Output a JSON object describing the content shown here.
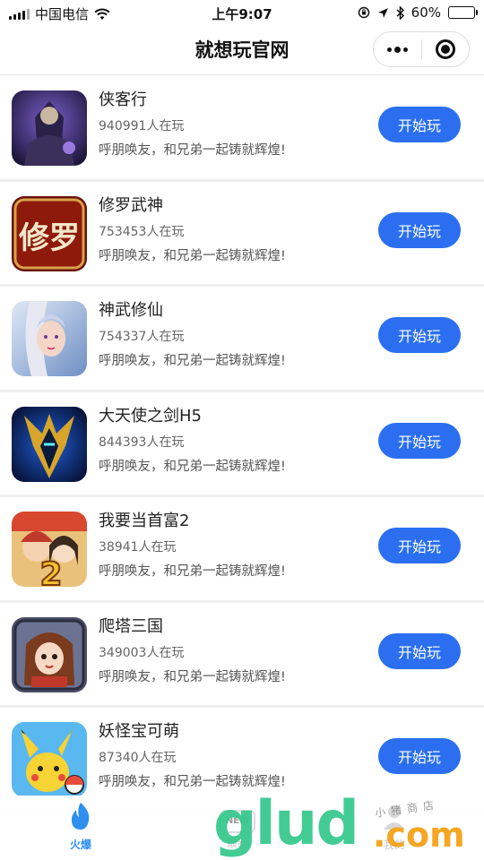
{
  "status_bar": {
    "carrier": "中国电信",
    "time": "上午9:07",
    "battery_text": "60%",
    "battery_level": 0.6
  },
  "nav": {
    "title": "就想玩官网"
  },
  "games": [
    {
      "name": "侠客行",
      "players": "940991人在玩",
      "slogan": "呼朋唤友，和兄弟一起铸就辉煌!",
      "button": "开始玩",
      "icon": "xiakexing-game-icon"
    },
    {
      "name": "修罗武神",
      "players": "753453人在玩",
      "slogan": "呼朋唤友，和兄弟一起铸就辉煌!",
      "button": "开始玩",
      "icon": "xiuluowushen-game-icon",
      "icon_text": "修罗"
    },
    {
      "name": "神武修仙",
      "players": "754337人在玩",
      "slogan": "呼朋唤友，和兄弟一起铸就辉煌!",
      "button": "开始玩",
      "icon": "shenwuxiuxian-game-icon"
    },
    {
      "name": "大天使之剑H5",
      "players": "844393人在玩",
      "slogan": "呼朋唤友，和兄弟一起铸就辉煌!",
      "button": "开始玩",
      "icon": "datianshi-game-icon"
    },
    {
      "name": "我要当首富2",
      "players": "38941人在玩",
      "slogan": "呼朋唤友，和兄弟一起铸就辉煌!",
      "button": "开始玩",
      "icon": "shoufu2-game-icon",
      "icon_text": "2"
    },
    {
      "name": "爬塔三国",
      "players": "349003人在玩",
      "slogan": "呼朋唤友，和兄弟一起铸就辉煌!",
      "button": "开始玩",
      "icon": "patasanguo-game-icon"
    },
    {
      "name": "妖怪宝可萌",
      "players": "87340人在玩",
      "slogan": "呼朋唤友，和兄弟一起铸就辉煌!",
      "button": "开始玩",
      "icon": "yaoguaibaokemeng-game-icon"
    }
  ],
  "tabbar": {
    "tabs": [
      {
        "label": "火爆",
        "icon": "flame-icon",
        "active": true
      },
      {
        "label": "最新",
        "icon": "new-icon",
        "icon_text": "NEW",
        "active": false
      },
      {
        "label": "我的",
        "icon": "user-icon",
        "active": false
      }
    ]
  },
  "watermark": {
    "brand": "glud",
    "domain": ".com",
    "shop": "小猪商店"
  },
  "colors": {
    "accent": "#2b6ff0",
    "tab_active": "#2f8ff0",
    "divider": "#efefef"
  }
}
